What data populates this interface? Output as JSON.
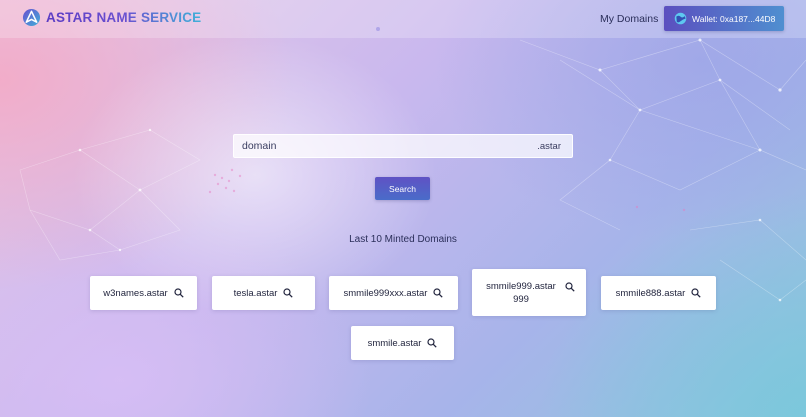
{
  "header": {
    "brand": "ASTAR NAME SERVICE",
    "nav_my_domains": "My Domains",
    "wallet_label": "Wallet: 0xa187...44D8"
  },
  "search": {
    "placeholder": "domain",
    "value": "",
    "tld": ".astar",
    "button_label": "Search"
  },
  "minted": {
    "title": "Last 10 Minted Domains",
    "domains": [
      "w3names.astar",
      "tesla.astar",
      "smmile999xxx.astar",
      "smmile999.astar 999",
      "smmile888.astar",
      "smmile.astar"
    ]
  },
  "colors": {
    "brand_start": "#5b3cc4",
    "brand_end": "#3fb0d8",
    "button": "#5b4fbf",
    "text": "#2b2f5a"
  },
  "icons": {
    "logo": "astar-logo-icon",
    "wallet": "globe-icon",
    "card_action": "search-icon"
  }
}
